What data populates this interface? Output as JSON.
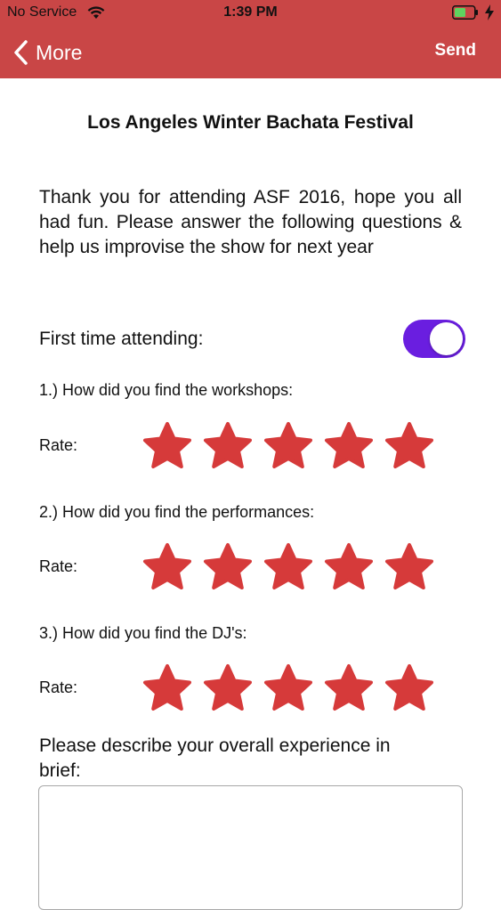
{
  "status_bar": {
    "carrier": "No Service",
    "time": "1:39 PM"
  },
  "nav": {
    "back_label": "More",
    "send_label": "Send"
  },
  "form": {
    "title": "Los Angeles Winter Bachata Festival",
    "intro": "Thank you for attending ASF 2016, hope you all had fun.  Please answer the following questions & help us improvise the show for next year",
    "first_time_label": "First time attending:",
    "first_time_on": true,
    "questions": [
      {
        "label": "1.) How did you find the workshops:",
        "rate_label": "Rate:",
        "rating": 5,
        "max": 5
      },
      {
        "label": "2.) How did you find the performances:",
        "rate_label": "Rate:",
        "rating": 5,
        "max": 5
      },
      {
        "label": "3.) How did you find the DJ's:",
        "rate_label": "Rate:",
        "rating": 5,
        "max": 5
      }
    ],
    "describe_label": "Please describe your overall experience in brief:",
    "describe_value": "",
    "describe_placeholder": ""
  },
  "colors": {
    "header": "#c94646",
    "toggle_on": "#6a1ee0",
    "star": "#d63a3a",
    "battery": "#5fd35f"
  }
}
